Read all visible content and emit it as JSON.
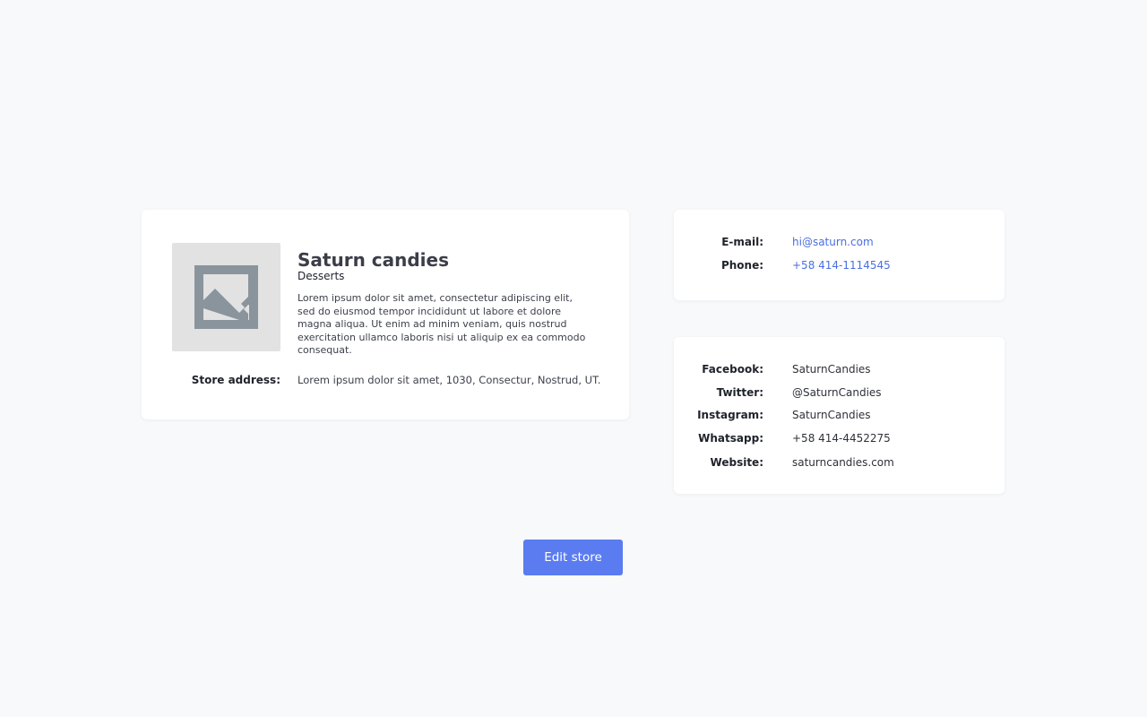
{
  "store": {
    "image_icon": "image-placeholder-icon",
    "name": "Saturn candies",
    "category": "Desserts",
    "description": "Lorem ipsum dolor sit amet, consectetur adipiscing elit, sed do eiusmod tempor incididunt ut labore et dolore magna aliqua. Ut enim ad minim veniam, quis nostrud exercitation ullamco laboris nisi ut aliquip ex ea commodo consequat.",
    "address_label": "Store address:",
    "address_value": "Lorem ipsum dolor sit amet, 1030, Consectur, Nostrud, UT."
  },
  "contact": {
    "email_label": "E-mail:",
    "email_value": "hi@saturn.com",
    "phone_label": "Phone:",
    "phone_value": "+58 414-1114545"
  },
  "social": {
    "facebook_label": "Facebook:",
    "facebook_value": "SaturnCandies",
    "twitter_label": "Twitter:",
    "twitter_value": "@SaturnCandies",
    "instagram_label": "Instagram:",
    "instagram_value": "SaturnCandies",
    "whatsapp_label": "Whatsapp:",
    "whatsapp_value": "+58 414-4452275",
    "website_label": "Website:",
    "website_value": "saturncandies.com"
  },
  "actions": {
    "edit_label": "Edit store"
  },
  "colors": {
    "background": "#f8f9fb",
    "card": "#ffffff",
    "accent": "#5a7cf0",
    "link": "#4a6fe0",
    "placeholder_bg": "#e2e2e2",
    "placeholder_icon": "#8a949c"
  }
}
